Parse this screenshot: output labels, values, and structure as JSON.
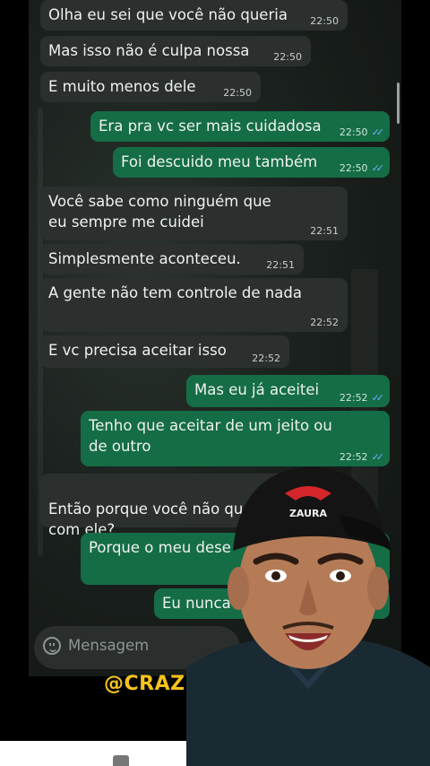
{
  "messages": [
    {
      "direction": "in",
      "text": "Olha eu sei que você não queria",
      "time": "22:50"
    },
    {
      "direction": "in",
      "text": "Mas isso não é culpa nossa",
      "time": "22:50"
    },
    {
      "direction": "in",
      "text": "E muito menos dele",
      "time": "22:50"
    },
    {
      "direction": "out",
      "text": "Era pra vc ser mais cuidadosa",
      "time": "22:50",
      "read": true
    },
    {
      "direction": "out",
      "text": "Foi descuido meu também",
      "time": "22:50",
      "read": true
    },
    {
      "direction": "in",
      "text": "Você sabe como ninguém que eu sempre me cuidei",
      "time": "22:51"
    },
    {
      "direction": "in",
      "text": "Simplesmente aconteceu.",
      "time": "22:51"
    },
    {
      "direction": "in",
      "text": "A gente não tem controle de nada",
      "time": "22:52"
    },
    {
      "direction": "in",
      "text": "E vc precisa aceitar isso",
      "time": "22:52"
    },
    {
      "direction": "out",
      "text": "Mas eu já aceitei",
      "time": "22:52",
      "read": true
    },
    {
      "direction": "out",
      "text": "Tenho que aceitar de um jeito ou de outro",
      "time": "22:52",
      "read": true
    },
    {
      "direction": "in",
      "text": "Então porque você não qu\ncom ele?",
      "time": ""
    },
    {
      "direction": "out",
      "text": "Porque o meu dese",
      "time": ""
    },
    {
      "direction": "out",
      "text": "Eu nunca",
      "time": ""
    }
  ],
  "composer": {
    "placeholder": "Mensagem"
  },
  "watermark": "@CRAZ",
  "cap_text": "ZAURA",
  "colors": {
    "incoming": "#2b302e",
    "outgoing": "#156d45",
    "ticks": "#65b3ff",
    "watermark": "#f4c31e"
  },
  "icons": [
    "emoji-icon",
    "read-ticks-icon",
    "scroll-down-icon"
  ]
}
